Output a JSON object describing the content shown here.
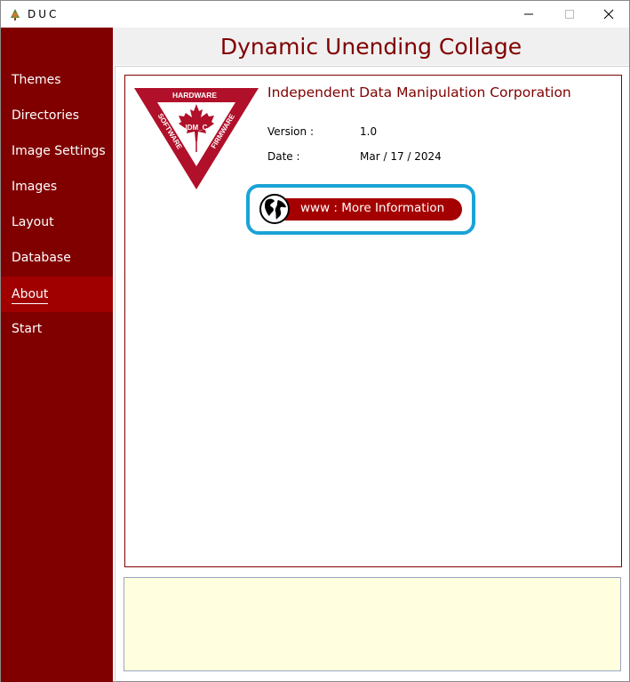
{
  "window": {
    "title": "DUC",
    "controls": {
      "minimize": "minimize",
      "maximize": "maximize",
      "close": "close"
    }
  },
  "sidebar": {
    "items": [
      {
        "label": "Themes",
        "active": false
      },
      {
        "label": "Directories",
        "active": false
      },
      {
        "label": "Image Settings",
        "active": false
      },
      {
        "label": "Images",
        "active": false
      },
      {
        "label": "Layout",
        "active": false
      },
      {
        "label": "Database",
        "active": false
      },
      {
        "label": "About",
        "active": true
      },
      {
        "label": "Start",
        "active": false
      }
    ]
  },
  "header": {
    "title": "Dynamic Unending Collage"
  },
  "about": {
    "company": "Independent Data Manipulation Corporation",
    "version_label": "Version :",
    "version_value": "1.0",
    "date_label": "Date :",
    "date_value": "Mar / 17 / 2024",
    "www_button": "www : More Information",
    "logo": {
      "top_text": "HARDWARE",
      "left_text": "SOFTWARE",
      "right_text": "FIRMWARE",
      "center_text": "IDM_C"
    }
  },
  "status": {
    "text": ""
  },
  "colors": {
    "sidebar": "#800000",
    "sidebar_active": "#a00000",
    "accent": "#800000",
    "button": "#a50000",
    "focus_ring": "#1aa3d6",
    "status_bg": "#ffffe0"
  }
}
